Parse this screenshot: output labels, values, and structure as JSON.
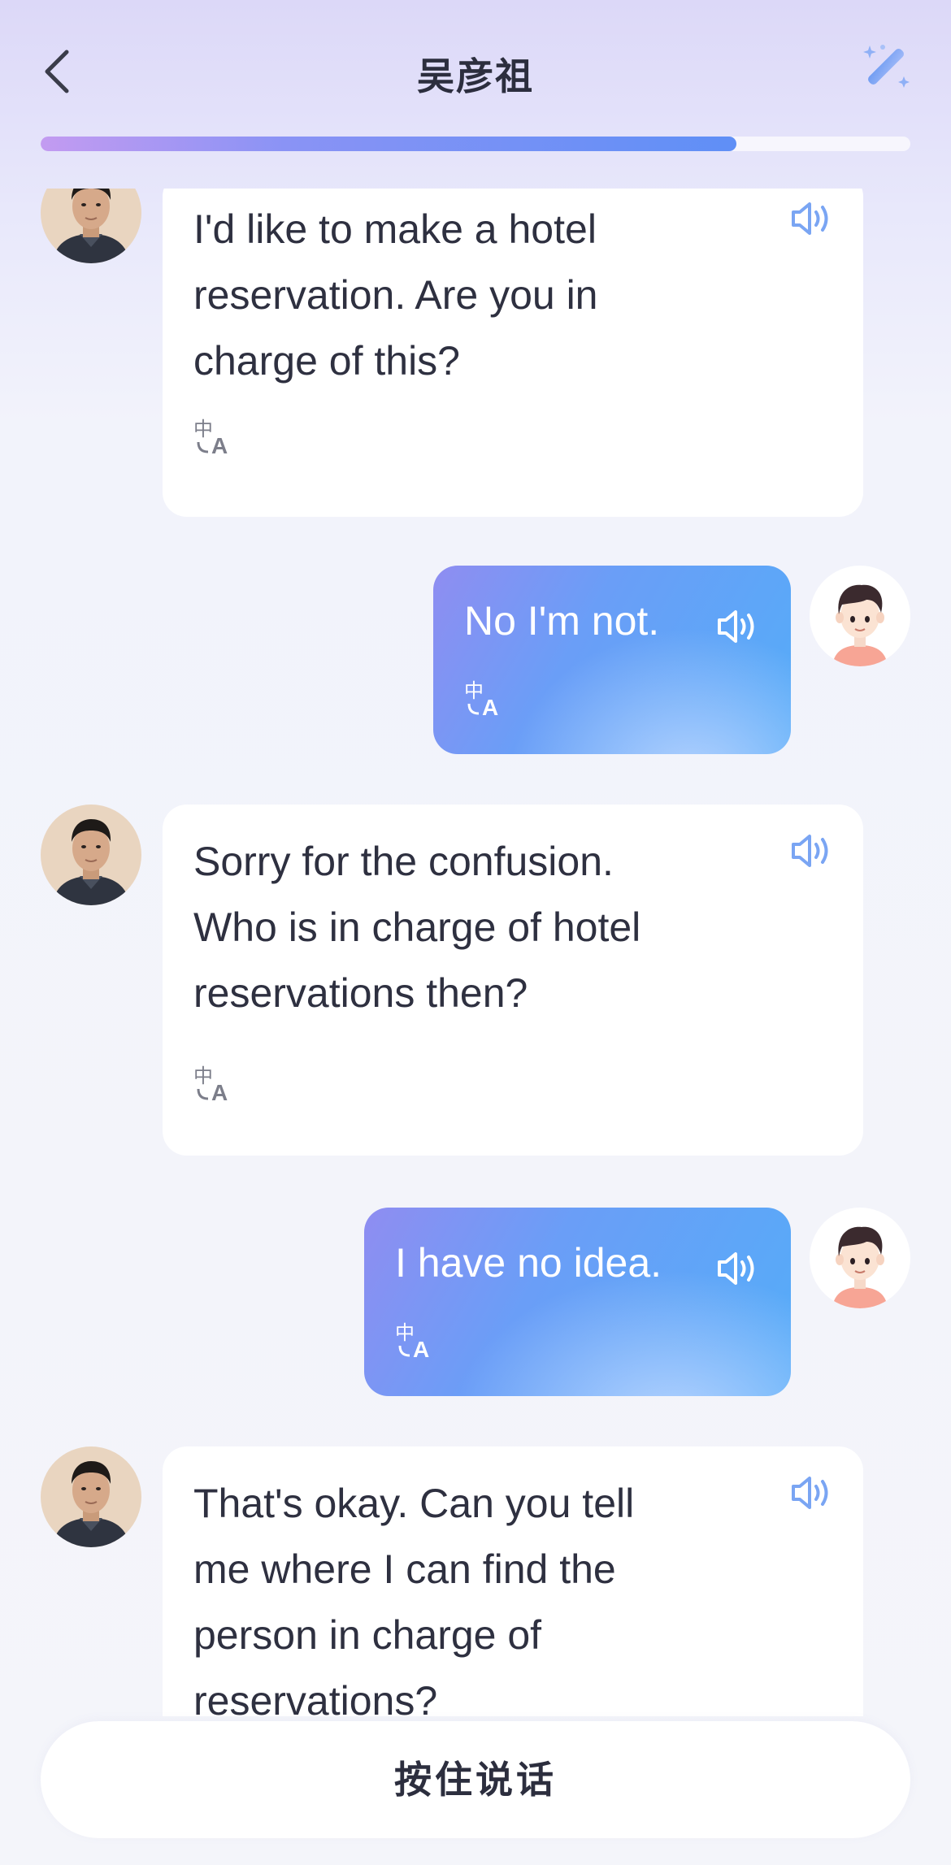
{
  "header": {
    "title": "吴彦祖",
    "back_icon": "chevron-left-icon",
    "magic_icon": "magic-wand-icon",
    "progress": 0.8
  },
  "messages": [
    {
      "role": "assistant",
      "text": "I'd like to make a hotel reservation. Are you in charge of this?"
    },
    {
      "role": "user",
      "text": "No I'm not."
    },
    {
      "role": "assistant",
      "text": "Sorry for the confusion. Who is in charge of hotel reservations then?"
    },
    {
      "role": "user",
      "text": "I have no idea."
    },
    {
      "role": "assistant",
      "text": "That's okay. Can you tell me where I can find the person in charge of reservations?"
    }
  ],
  "icons": {
    "speaker": "speaker-icon",
    "translate": "translate-icon"
  },
  "colors": {
    "accent": "#6a9ef7",
    "bubble_user_start": "#8f8df1",
    "bubble_user_end": "#55acf8",
    "text": "#2e3040"
  },
  "footer": {
    "hold_to_talk_label": "按住说话"
  }
}
